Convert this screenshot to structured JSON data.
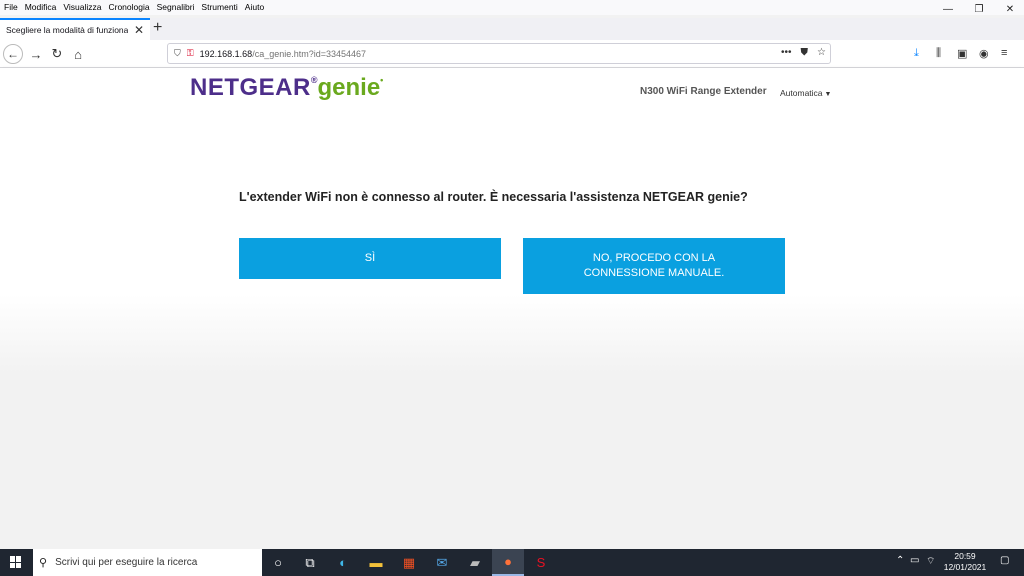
{
  "menu": [
    "File",
    "Modifica",
    "Visualizza",
    "Cronologia",
    "Segnalibri",
    "Strumenti",
    "Aiuto"
  ],
  "window_controls": {
    "minimize": "—",
    "restore": "❐",
    "close": "✕"
  },
  "tab": {
    "title": "Scegliere la modalità di funzionamento",
    "close": "✕",
    "new": "+"
  },
  "address": {
    "host": "192.168.1.68",
    "path": "/ca_genie.htm?id=33454467"
  },
  "header": {
    "logo_netgear": "NETGEAR",
    "logo_reg": "®",
    "logo_genie": "genie",
    "product": "N300 WiFi Range Extender",
    "language": "Automatica"
  },
  "main": {
    "question": "L'extender WiFi non è connesso al router. È necessaria l'assistenza NETGEAR genie?",
    "yes_button": "SÌ",
    "no_button": "NO, PROCEDO CON LA CONNESSIONE MANUALE."
  },
  "taskbar": {
    "search_placeholder": "Scrivi qui per eseguire la ricerca",
    "time": "20:59",
    "date": "12/01/2021"
  },
  "colors": {
    "accent_button": "#0aa0e0",
    "netgear_purple": "#4d2e8a",
    "genie_green": "#6aa91e"
  }
}
